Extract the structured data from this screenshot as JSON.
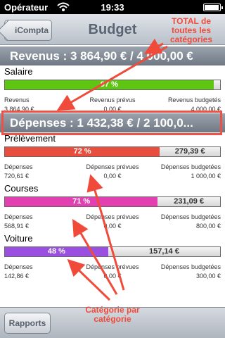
{
  "status_bar": {
    "carrier": "Opérateur",
    "time": "19:33"
  },
  "nav": {
    "back_label": "iCompta",
    "title": "Budget"
  },
  "revenus": {
    "header": "Revenus : 3 864,90 € / 4 000,00 €",
    "categories": [
      {
        "name": "Salaire",
        "percent_label": "97 %",
        "fraction": 0.97,
        "remaining": "",
        "color": "#5ec512",
        "labels": [
          "Revenus",
          "Revenus prévus",
          "Revenus budgetés"
        ],
        "values": [
          "3 864,90 €",
          "0,00 €",
          "4 000,00 €"
        ]
      }
    ]
  },
  "depenses": {
    "header": "Dépenses : 1 432,38 € / 2 100,0...",
    "categories": [
      {
        "name": "Prélèvement",
        "percent_label": "72 %",
        "fraction": 0.72,
        "remaining": "279,39 €",
        "color": "#e84e3d",
        "labels": [
          "Dépenses",
          "Dépenses prévues",
          "Dépenses budgetées"
        ],
        "values": [
          "720,61 €",
          "0,00 €",
          "1 000,00 €"
        ]
      },
      {
        "name": "Courses",
        "percent_label": "71 %",
        "fraction": 0.71,
        "remaining": "231,09 €",
        "color": "#e23fb1",
        "labels": [
          "Dépenses",
          "Dépenses prévues",
          "Dépenses budgetées"
        ],
        "values": [
          "568,91 €",
          "0,00 €",
          "800,00 €"
        ]
      },
      {
        "name": "Voiture",
        "percent_label": "48 %",
        "fraction": 0.48,
        "remaining": "157,14 €",
        "color": "#9b4fe0",
        "labels": [
          "Dépenses",
          "Dépenses prévues",
          "Dépenses budgetées"
        ],
        "values": [
          "142,86 €",
          "0,00 €",
          "300,00 €"
        ]
      }
    ]
  },
  "toolbar": {
    "rapports_label": "Rapports"
  },
  "annotations": {
    "total_line1": "TOTAL de",
    "total_line2": "toutes les",
    "total_line3": "catégories",
    "cat_line1": "Catégorie par",
    "cat_line2": "catégorie",
    "color": "#f04a3a"
  }
}
